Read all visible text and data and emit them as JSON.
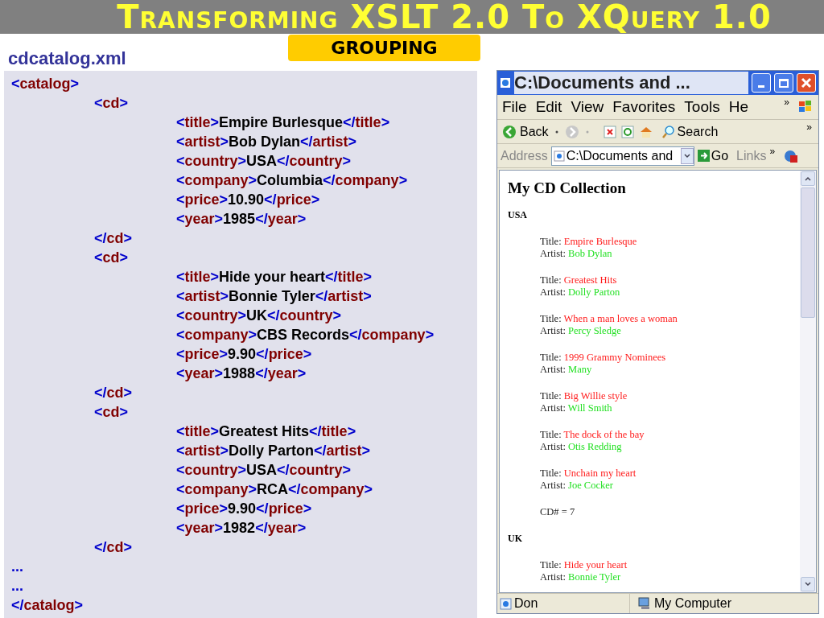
{
  "slide": {
    "title": "Transforming XSLT 2.0 To XQuery 1.0",
    "badge": "GROUPING",
    "file_label": "cdcatalog.xml"
  },
  "xml_listing": [
    {
      "kind": "element",
      "open": "<catalog>",
      "close": "</catalog>",
      "children": [
        {
          "kind": "element",
          "open": "<cd>",
          "close": "</cd>",
          "children": [
            {
              "kind": "field",
              "open": "<title>",
              "text": "Empire Burlesque",
              "close": "</title>"
            },
            {
              "kind": "field",
              "open": "<artist>",
              "text": "Bob Dylan",
              "close": "</artist>"
            },
            {
              "kind": "field",
              "open": "<country>",
              "text": "USA",
              "close": "</country>"
            },
            {
              "kind": "field",
              "open": "<company>",
              "text": "Columbia",
              "close": "</company>"
            },
            {
              "kind": "field",
              "open": "<price>",
              "text": "10.90",
              "close": "</price>"
            },
            {
              "kind": "field",
              "open": "<year>",
              "text": "1985",
              "close": "</year>"
            }
          ]
        },
        {
          "kind": "element",
          "open": "<cd>",
          "close": "</cd>",
          "children": [
            {
              "kind": "field",
              "open": "<title>",
              "text": "Hide your heart",
              "close": "</title>"
            },
            {
              "kind": "field",
              "open": "<artist>",
              "text": "Bonnie Tyler",
              "close": "</artist>"
            },
            {
              "kind": "field",
              "open": "<country>",
              "text": "UK",
              "close": "</country>"
            },
            {
              "kind": "field",
              "open": "<company>",
              "text": "CBS Records",
              "close": "</company>"
            },
            {
              "kind": "field",
              "open": "<price>",
              "text": "9.90",
              "close": "</price>"
            },
            {
              "kind": "field",
              "open": "<year>",
              "text": "1988",
              "close": "</year>"
            }
          ]
        },
        {
          "kind": "element",
          "open": "<cd>",
          "close": "</cd>",
          "children": [
            {
              "kind": "field",
              "open": "<title>",
              "text": "Greatest Hits",
              "close": "</title>"
            },
            {
              "kind": "field",
              "open": "<artist>",
              "text": "Dolly Parton",
              "close": "</artist>"
            },
            {
              "kind": "field",
              "open": "<country>",
              "text": "USA",
              "close": "</country>"
            },
            {
              "kind": "field",
              "open": "<company>",
              "text": "RCA",
              "close": "</company>"
            },
            {
              "kind": "field",
              "open": "<price>",
              "text": "9.90",
              "close": "</price>"
            },
            {
              "kind": "field",
              "open": "<year>",
              "text": "1982",
              "close": "</year>"
            }
          ]
        },
        {
          "kind": "ellipsis",
          "text": "..."
        },
        {
          "kind": "ellipsis",
          "text": "..."
        }
      ]
    }
  ],
  "browser": {
    "title": "C:\\Documents and ...",
    "menu": [
      "File",
      "Edit",
      "View",
      "Favorites",
      "Tools",
      "He"
    ],
    "menu_more": "»",
    "toolbar": {
      "back": "Back",
      "search": "Search",
      "more": "»"
    },
    "address": {
      "label": "Address",
      "value": "C:\\Documents and",
      "go": "Go",
      "links": "Links",
      "more": "»"
    },
    "page": {
      "heading": "My CD Collection",
      "groups": [
        {
          "country": "USA",
          "cds": [
            {
              "title_label": "Title:",
              "title": "Empire Burlesque",
              "artist_label": "Artist:",
              "artist": "Bob Dylan"
            },
            {
              "title_label": "Title:",
              "title": "Greatest Hits",
              "artist_label": "Artist:",
              "artist": "Dolly Parton"
            },
            {
              "title_label": "Title:",
              "title": "When a man loves a woman",
              "artist_label": "Artist:",
              "artist": "Percy Sledge"
            },
            {
              "title_label": "Title:",
              "title": "1999 Grammy Nominees",
              "artist_label": "Artist:",
              "artist": "Many"
            },
            {
              "title_label": "Title:",
              "title": "Big Willie style",
              "artist_label": "Artist:",
              "artist": "Will Smith"
            },
            {
              "title_label": "Title:",
              "title": "The dock of the bay",
              "artist_label": "Artist:",
              "artist": "Otis Redding"
            },
            {
              "title_label": "Title:",
              "title": "Unchain my heart",
              "artist_label": "Artist:",
              "artist": "Joe Cocker"
            }
          ],
          "count": "CD# = 7"
        },
        {
          "country": "UK",
          "cds": [
            {
              "title_label": "Title:",
              "title": "Hide your heart",
              "artist_label": "Artist:",
              "artist": "Bonnie Tyler"
            }
          ]
        }
      ]
    },
    "status": {
      "left": "Don",
      "zone": "My Computer"
    }
  }
}
